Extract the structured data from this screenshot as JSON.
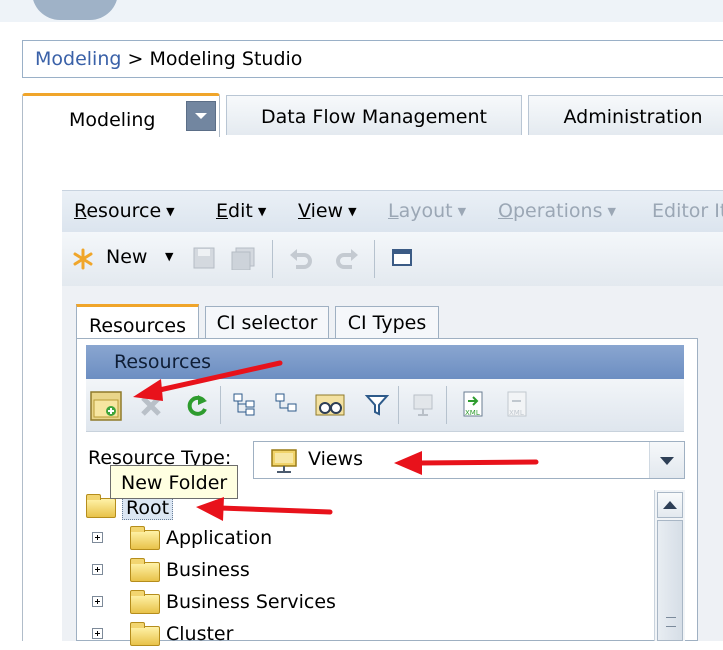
{
  "breadcrumb": {
    "link": "Modeling",
    "separator": " > ",
    "current": "Modeling Studio"
  },
  "main_tabs": [
    {
      "label": "Modeling",
      "active": true
    },
    {
      "label": "Data Flow Management"
    },
    {
      "label": "Administration"
    }
  ],
  "menubar": [
    {
      "label": "Resource",
      "underline": "R",
      "enabled": true
    },
    {
      "label": "Edit",
      "underline": "E",
      "enabled": true
    },
    {
      "label": "View",
      "underline": "V",
      "enabled": true
    },
    {
      "label": "Layout",
      "underline": "L",
      "enabled": false
    },
    {
      "label": "Operations",
      "underline": "O",
      "enabled": false
    },
    {
      "label": "Editor It",
      "enabled": false
    }
  ],
  "toolbar": {
    "new_label": "New"
  },
  "sub_tabs": [
    {
      "label": "Resources",
      "active": true
    },
    {
      "label": "CI selector"
    },
    {
      "label": "CI Types"
    }
  ],
  "resources_panel": {
    "header": "Resources"
  },
  "resource_type": {
    "label": "Resource Type:",
    "value": "Views"
  },
  "tooltip": {
    "text": "New Folder"
  },
  "tree": {
    "root": "Root",
    "items": [
      "Application",
      "Business",
      "Business Services",
      "Cluster"
    ]
  },
  "colors": {
    "accent_tab": "#f0a52a",
    "annotation_arrow": "#e8121b",
    "header_blue": "#7b9ac9"
  }
}
